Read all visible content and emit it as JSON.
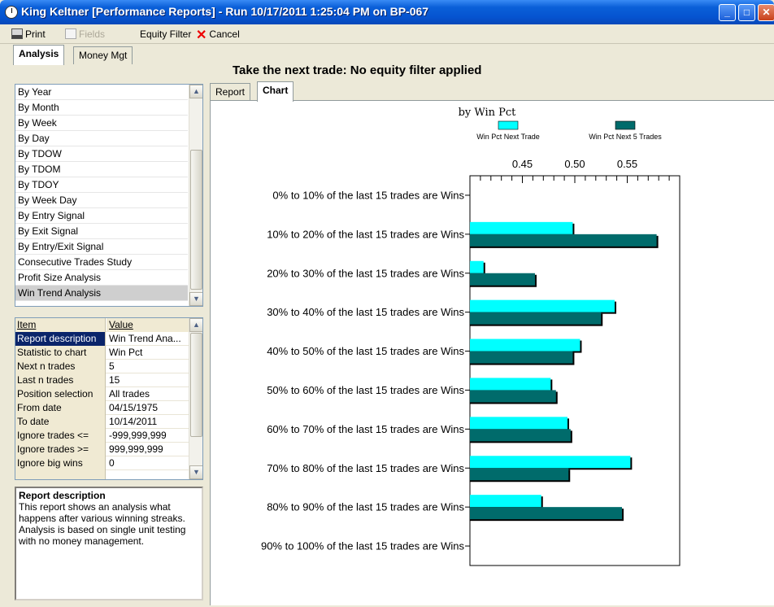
{
  "window": {
    "title": "King Keltner  [Performance Reports]  - Run 10/17/2011 1:25:04 PM on BP-067"
  },
  "toolbar": {
    "print": "Print",
    "fields": "Fields",
    "equity_filter": "Equity Filter",
    "cancel": "Cancel"
  },
  "left_tabs": [
    "Analysis",
    "Money Mgt"
  ],
  "analysis_list": {
    "items": [
      "By Year",
      "By Month",
      "By Week",
      "By Day",
      "By TDOW",
      "By TDOM",
      "By TDOY",
      "By Week Day",
      "By Entry Signal",
      "By Exit Signal",
      "By Entry/Exit Signal",
      "Consecutive Trades Study",
      "Profit Size Analysis",
      "Win Trend Analysis"
    ],
    "selected": "Win Trend Analysis"
  },
  "properties": {
    "header": {
      "item": "Item",
      "value": "Value"
    },
    "rows": [
      {
        "item": "Report description",
        "value": "Win Trend Ana..."
      },
      {
        "item": "Statistic to chart",
        "value": "Win Pct"
      },
      {
        "item": "Next n trades",
        "value": "5"
      },
      {
        "item": "Last n trades",
        "value": "15"
      },
      {
        "item": "Position selection",
        "value": "All trades"
      },
      {
        "item": "From date",
        "value": "04/15/1975"
      },
      {
        "item": "To date",
        "value": "10/14/2011"
      },
      {
        "item": "Ignore trades <=",
        "value": "-999,999,999"
      },
      {
        "item": "Ignore trades >=",
        "value": "999,999,999"
      },
      {
        "item": "Ignore big wins",
        "value": "0"
      }
    ]
  },
  "description": {
    "title": "Report description",
    "body": "This report shows an analysis what happens after various winning streaks. Analysis is based on single unit testing with no money management."
  },
  "headline": "Take the next trade: No equity filter applied",
  "right_tabs": [
    "Report",
    "Chart"
  ],
  "colors": {
    "series1": "#00ffff",
    "series2": "#006b6b"
  },
  "chart_data": {
    "type": "bar",
    "orientation": "horizontal",
    "title": "by Win Pct",
    "categories": [
      "0% to 10% of the last 15 trades are Wins",
      "10% to 20% of the last 15 trades are Wins",
      "20% to 30% of the last 15 trades are Wins",
      "30% to 40% of the last 15 trades are Wins",
      "40% to 50% of the last 15 trades are Wins",
      "50% to 60% of the last 15 trades are Wins",
      "60% to 70% of the last 15 trades are Wins",
      "70% to 80% of the last 15 trades are Wins",
      "80% to 90% of the last 15 trades are Wins",
      "90% to 100% of the last 15 trades are Wins"
    ],
    "series": [
      {
        "name": "Win Pct Next Trade",
        "values": [
          null,
          0.498,
          0.413,
          0.538,
          0.505,
          0.477,
          0.493,
          0.553,
          0.468,
          null
        ]
      },
      {
        "name": "Win Pct Next 5 Trades",
        "values": [
          null,
          0.578,
          0.462,
          0.525,
          0.498,
          0.482,
          0.496,
          0.494,
          0.545,
          null
        ]
      }
    ],
    "xticks": [
      0.45,
      0.5,
      0.55
    ],
    "xlim": [
      0.4,
      0.6
    ],
    "legend_position": "top",
    "axis_position": "top"
  }
}
